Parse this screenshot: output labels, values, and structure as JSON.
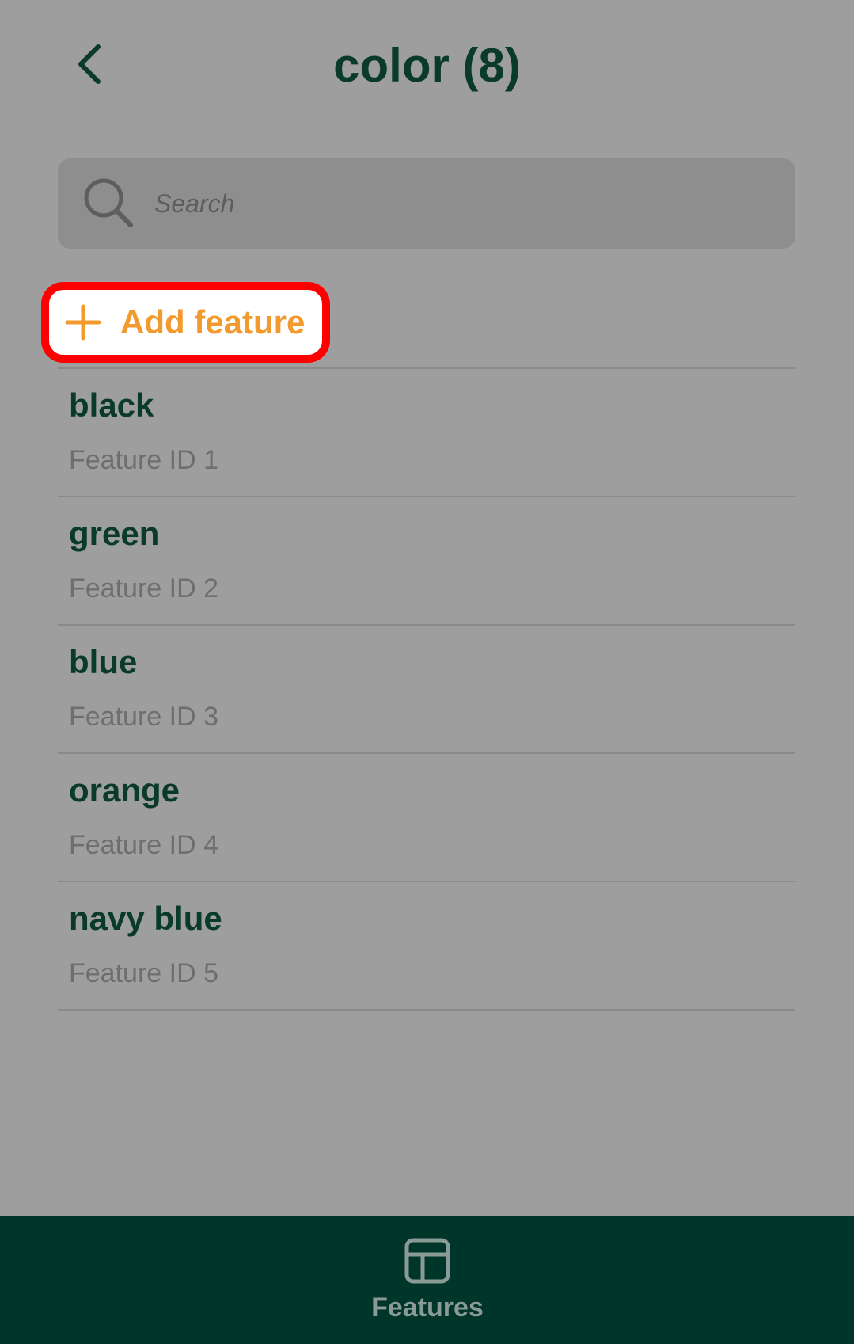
{
  "header": {
    "title": "color (8)",
    "back_icon": "chevron-left-icon"
  },
  "search": {
    "placeholder": "Search",
    "value": "",
    "icon": "search-icon"
  },
  "add_feature": {
    "label": "Add feature",
    "icon": "plus-icon",
    "highlight_color": "#ff0000",
    "text_color": "#f29a2e"
  },
  "features": [
    {
      "name": "black",
      "subtitle": "Feature ID 1"
    },
    {
      "name": "green",
      "subtitle": "Feature ID 2"
    },
    {
      "name": "blue",
      "subtitle": "Feature ID 3"
    },
    {
      "name": "orange",
      "subtitle": "Feature ID 4"
    },
    {
      "name": "navy blue",
      "subtitle": "Feature ID 5"
    }
  ],
  "bottom_nav": {
    "tabs": [
      {
        "label": "Features",
        "icon": "table-grid-icon"
      }
    ],
    "background": "#00352a"
  },
  "colors": {
    "primary_dark": "#0a3a2a",
    "accent": "#f29a2e",
    "overlay_bg": "#9e9e9e"
  }
}
